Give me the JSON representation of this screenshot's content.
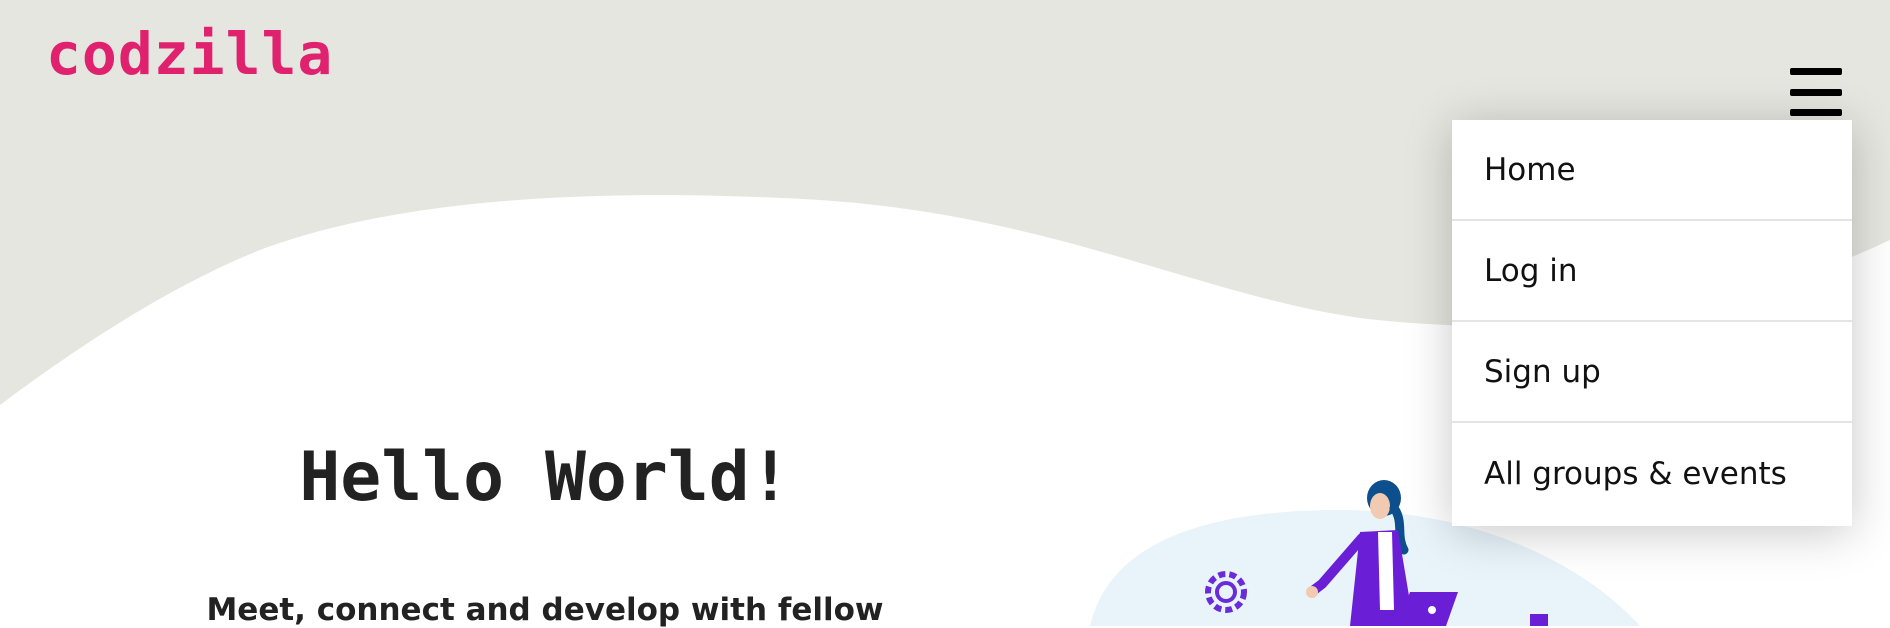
{
  "brand": {
    "logo_text": "codzilla",
    "accent_color": "#e0226e"
  },
  "header": {
    "menu_icon": "hamburger-menu-icon",
    "menu_open": true
  },
  "menu": {
    "items": [
      {
        "label": "Home"
      },
      {
        "label": "Log in"
      },
      {
        "label": "Sign up"
      },
      {
        "label": "All groups & events"
      }
    ]
  },
  "hero": {
    "title": "Hello World!",
    "subtitle": "Meet, connect and develop with fellow",
    "background_color": "#e6e6e0"
  },
  "illustration": {
    "icons": [
      "gear-icon",
      "laptop-icon",
      "person-figure"
    ]
  }
}
